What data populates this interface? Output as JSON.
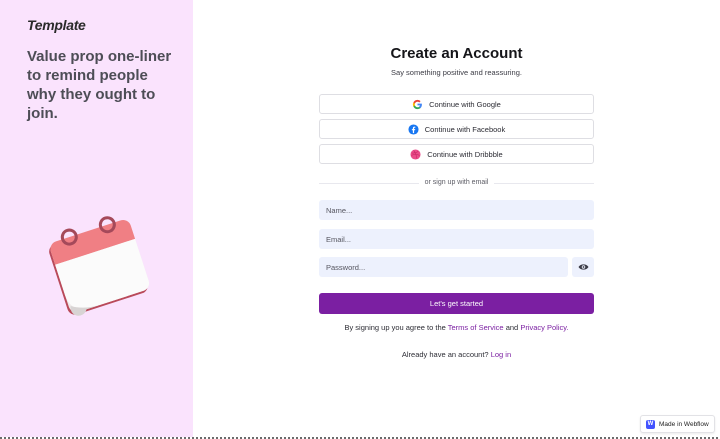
{
  "brand": {
    "name": "Template"
  },
  "left_panel": {
    "tagline": "Value prop one-liner to remind people why they ought to join."
  },
  "form": {
    "title": "Create an Account",
    "subtitle": "Say something positive and reassuring.",
    "social_buttons": [
      {
        "label": "Continue with Google",
        "icon": "google-icon"
      },
      {
        "label": "Continue with Facebook",
        "icon": "facebook-icon"
      },
      {
        "label": "Continue with Dribbble",
        "icon": "dribbble-icon"
      }
    ],
    "divider_text": "or sign up with email",
    "name_placeholder": "Name...",
    "email_placeholder": "Email...",
    "password_placeholder": "Password...",
    "submit_label": "Let's get started",
    "terms_prefix": "By signing up you agree to the",
    "terms_link": "Terms of Service",
    "terms_and": "and",
    "privacy_link": "Privacy Policy.",
    "login_prompt": "Already have an account?",
    "login_link": "Log in"
  },
  "badge": {
    "label": "Made in Webflow",
    "icon_letter": "W"
  },
  "colors": {
    "accent": "#7b1fa2",
    "left_bg": "#fae3fd",
    "field_bg": "#edf1fd"
  }
}
